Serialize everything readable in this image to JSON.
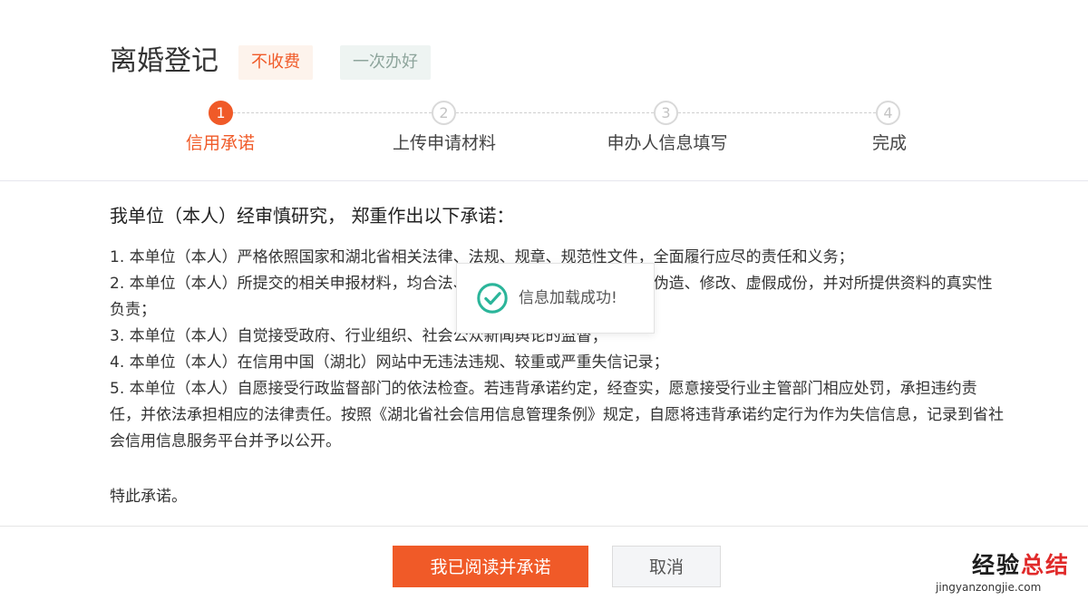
{
  "header": {
    "title": "离婚登记",
    "tags": [
      {
        "label": "不收费"
      },
      {
        "label": "一次办好"
      }
    ]
  },
  "steps": [
    {
      "number": "1",
      "label": "信用承诺",
      "state": "active"
    },
    {
      "number": "2",
      "label": "上传申请材料",
      "state": "pending"
    },
    {
      "number": "3",
      "label": "申办人信息填写",
      "state": "pending"
    },
    {
      "number": "4",
      "label": "完成",
      "state": "pending"
    }
  ],
  "content": {
    "intro": "我单位（本人）经审慎研究， 郑重作出以下承诺：",
    "items": [
      "1. 本单位（本人）严格依照国家和湖北省相关法律、法规、规章、规范性文件，全面履行应尽的责任和义务；",
      "2. 本单位（本人）所提交的相关申报材料，均合法、真实、准确、有效，无任何伪造、修改、虚假成份，并对所提供资料的真实性负责；",
      "3. 本单位（本人）自觉接受政府、行业组织、社会公众新闻舆论的监督；",
      "4. 本单位（本人）在信用中国（湖北）网站中无违法违规、较重或严重失信记录；",
      "5. 本单位（本人）自愿接受行政监督部门的依法检查。若违背承诺约定，经查实，愿意接受行业主管部门相应处罚，承担违约责任，并依法承担相应的法律责任。按照《湖北省社会信用信息管理条例》规定，自愿将违背承诺约定行为作为失信信息，记录到省社会信用信息服务平台并予以公开。"
    ],
    "closing": "特此承诺。"
  },
  "toast": {
    "message": "信息加载成功!",
    "icon": "check-circle-icon"
  },
  "buttons": {
    "confirm": "我已阅读并承诺",
    "cancel": "取消"
  },
  "watermark": {
    "part1": "经验",
    "part2": "总结",
    "url": "jingyanzongjie.com"
  },
  "colors": {
    "accent": "#f05a28",
    "success": "#2bb59a",
    "tag_free_bg": "#fdf3ec",
    "tag_once_bg": "#eef4f2"
  }
}
